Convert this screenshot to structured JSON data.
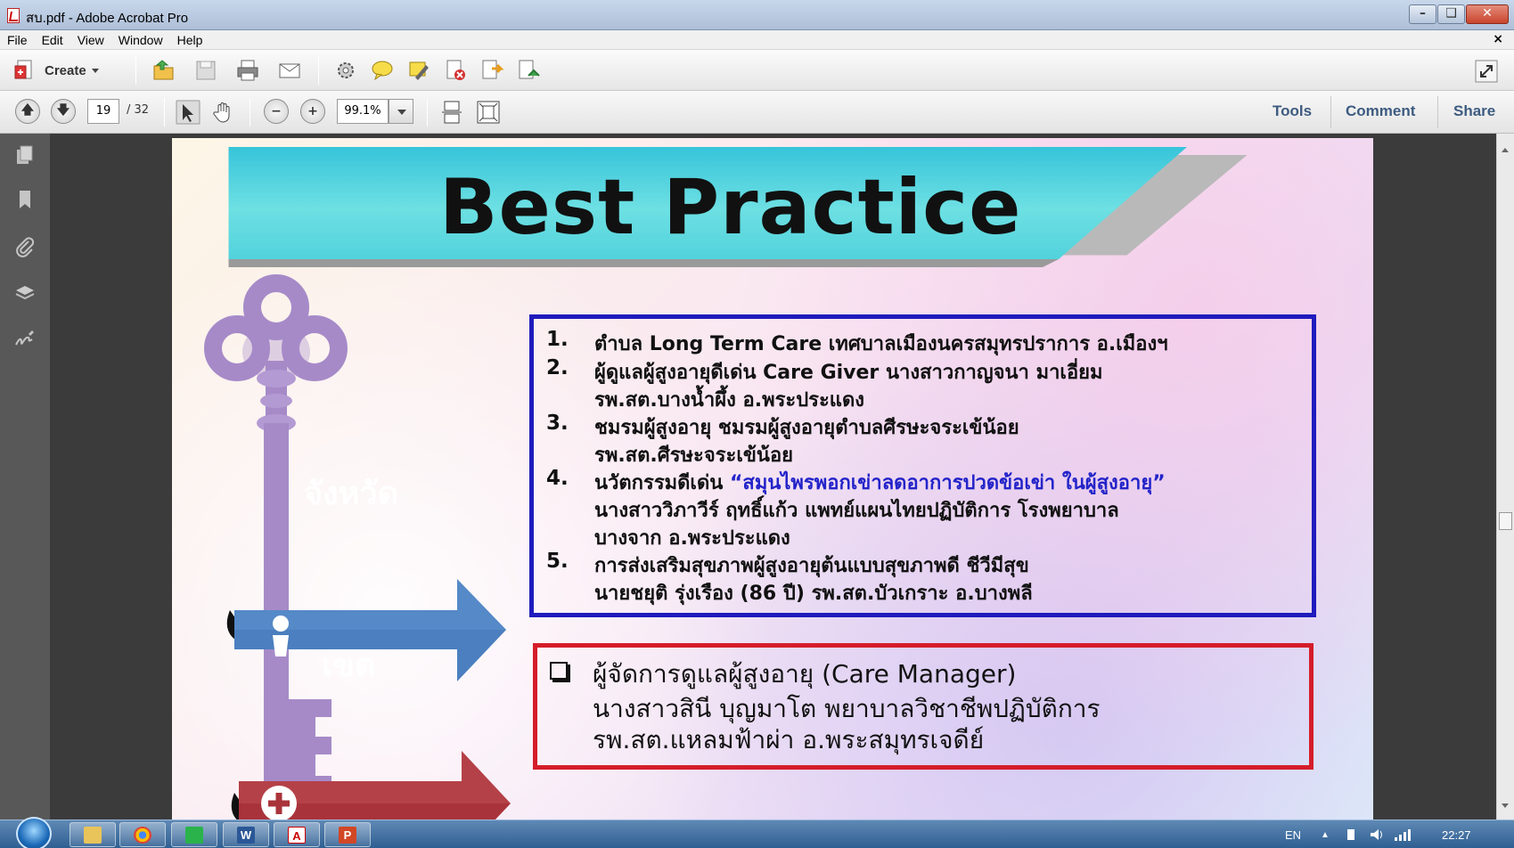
{
  "window": {
    "title": "สบ.pdf - Adobe Acrobat Pro"
  },
  "menu": {
    "items": [
      "File",
      "Edit",
      "View",
      "Window",
      "Help"
    ],
    "close_glyph": "×"
  },
  "toolbar": {
    "create_label": "Create",
    "page_current": "19",
    "page_total": "/ 32",
    "zoom_value": "99.1%",
    "panel_links": [
      "Tools",
      "Comment",
      "Share"
    ]
  },
  "icons": {
    "top_toolbar": [
      "open-icon",
      "save-icon",
      "print-icon",
      "email-icon",
      "settings-icon",
      "comment-icon",
      "highlight-icon",
      "delete-pages-icon",
      "extract-pages-icon",
      "insert-pages-icon",
      "fullscreen-icon"
    ],
    "nav_toolbar": [
      "prev-page-icon",
      "next-page-icon",
      "select-tool-icon",
      "hand-tool-icon",
      "zoom-out-icon",
      "zoom-in-icon",
      "scrolling-mode-icon",
      "fit-page-icon"
    ],
    "navpane": [
      "pages-icon",
      "bookmarks-icon",
      "attachments-icon",
      "layers-icon",
      "signatures-icon"
    ]
  },
  "slide": {
    "title": "Best  Practice",
    "arrow1_label": "จังหวัด",
    "arrow2_label": "เขต",
    "blue_box": {
      "items": [
        {
          "num": "1.",
          "lines": [
            "ตำบล  Long Term Care  เทศบาลเมืองนครสมุทรปราการ อ.เมืองฯ"
          ]
        },
        {
          "num": "2.",
          "lines": [
            "ผู้ดูแลผู้สูงอายุดีเด่น Care Giver  นางสาวกาญจนา มาเอี่ยม",
            " รพ.สต.บางน้ำผึ้ง  อ.พระประแดง"
          ]
        },
        {
          "num": "3.",
          "lines": [
            "ชมรมผู้สูงอายุ  ชมรมผู้สูงอายุตำบลศีรษะจระเข้น้อย",
            "รพ.สต.ศีรษะจระเข้น้อย"
          ]
        },
        {
          "num": "4.",
          "lines_prefix": "นวัตกรรมดีเด่น ",
          "quote": "“สมุนไพรพอกเข่าลดอาการปวดข้อเข่า ในผู้สูงอายุ”",
          "lines": [
            "นางสาววิภาวีร์ ฤทธิ์แก้ว  แพทย์แผนไทยปฏิบัติการ   โรงพยาบาล",
            "บางจาก   อ.พระประแดง"
          ]
        },
        {
          "num": "5.",
          "lines": [
            "การส่งเสริมสุขภาพผู้สูงอายุต้นแบบสุขภาพดี  ชีวีมีสุข",
            "นายชยุติ   รุ่งเรือง (86 ปี)   รพ.สต.บัวเกราะ  อ.บางพลี"
          ]
        }
      ]
    },
    "red_box": {
      "lines": [
        "ผู้จัดการดูแลผู้สูงอายุ (Care Manager)",
        "นางสาวสินี บุญมาโต พยาบาลวิชาชีพปฏิบัติการ",
        "รพ.สต.แหลมฟ้าผ่า อ.พระสมุทรเจดีย์"
      ]
    }
  },
  "taskbar": {
    "apps": [
      "explorer",
      "chrome",
      "line",
      "word",
      "acrobat",
      "powerpoint"
    ],
    "lang": "EN",
    "clock": "22:27"
  },
  "colors": {
    "banner_teal": "#4fd6df",
    "arrow_blue": "#4b7fbf",
    "arrow_red": "#a9333a",
    "key_purple": "#a68ac8",
    "blue_border": "#1f1bbd",
    "red_border": "#d51d2a"
  }
}
